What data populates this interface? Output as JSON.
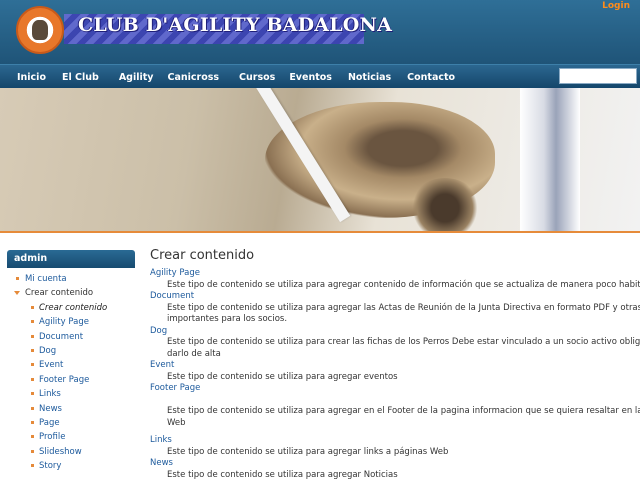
{
  "header": {
    "title": "CLUB D'AGILITY BADALONA",
    "login_label": "Login"
  },
  "nav": {
    "items": [
      "Inicio",
      "El Club",
      "Agility",
      "Canicross",
      "Cursos",
      "Eventos",
      "Noticias",
      "Contacto"
    ]
  },
  "sidebar": {
    "title": "admin",
    "items": [
      {
        "label": "Mi cuenta",
        "level": 1
      },
      {
        "label": "Crear contenido",
        "level": 1
      },
      {
        "label": "Crear contenido",
        "level": 2
      },
      {
        "label": "Agility Page",
        "level": 2
      },
      {
        "label": "Document",
        "level": 2
      },
      {
        "label": "Dog",
        "level": 2
      },
      {
        "label": "Event",
        "level": 2
      },
      {
        "label": "Footer Page",
        "level": 2
      },
      {
        "label": "Links",
        "level": 2
      },
      {
        "label": "News",
        "level": 2
      },
      {
        "label": "Page",
        "level": 2
      },
      {
        "label": "Profile",
        "level": 2
      },
      {
        "label": "Slideshow",
        "level": 2
      },
      {
        "label": "Story",
        "level": 2
      }
    ]
  },
  "main": {
    "title": "Crear contenido",
    "content_types": [
      {
        "name": "Agility Page",
        "desc": [
          "Este tipo de contenido se utiliza para agregar contenido de información que se actualiza de manera poco habitual en Agili"
        ]
      },
      {
        "name": "Document",
        "desc": [
          "Este tipo de contenido se utiliza para agregar las Actas de Reunión de la Junta Directiva en formato PDF y otras informacio",
          "importantes para los socios."
        ]
      },
      {
        "name": "Dog",
        "desc": [
          "Este tipo de contenido se utiliza para crear las fichas de los Perros Debe estar vinculado a un socio activo obligatoriamen",
          "darlo de alta"
        ]
      },
      {
        "name": "Event",
        "desc": [
          "Este tipo de contenido se utiliza para agregar eventos"
        ]
      },
      {
        "name": "Footer Page",
        "desc": [
          "",
          "Este tipo de contenido se utiliza para agregar en el Footer de la pagina informacion que se quiera resaltar en la parte infer",
          "Web"
        ]
      },
      {
        "name": "Links",
        "desc": [
          "Este tipo de contenido se utiliza para agregar links a páginas Web"
        ]
      },
      {
        "name": "News",
        "desc": [
          "Este tipo de contenido se utiliza para agregar Noticias"
        ]
      }
    ]
  },
  "colors": {
    "header_bg": "#1f5478",
    "nav_bg": "#14466b",
    "link": "#1d5a9c",
    "accent": "#e58a3a",
    "login": "#ff8c1a"
  }
}
